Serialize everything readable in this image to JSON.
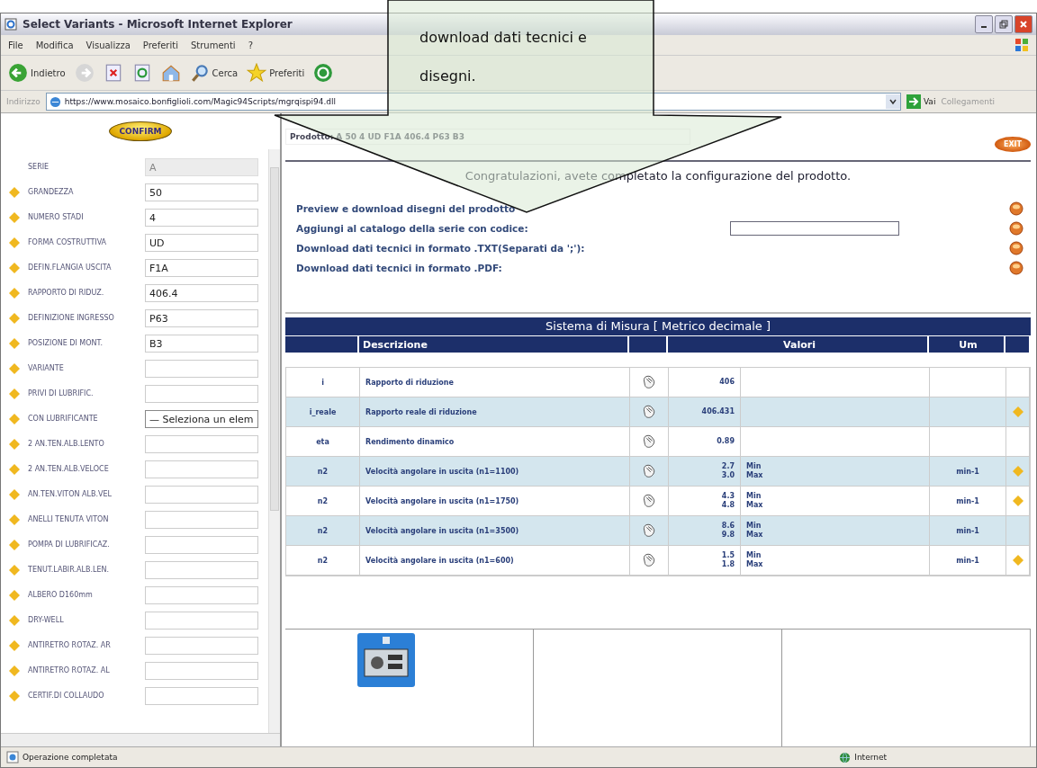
{
  "callout": {
    "text": "download dati tecnici e disegni."
  },
  "window": {
    "title": "Select Variants - Microsoft Internet Explorer"
  },
  "menu": [
    "File",
    "Modifica",
    "Visualizza",
    "Preferiti",
    "Strumenti",
    "?"
  ],
  "toolbar": [
    {
      "kind": "back",
      "label": "Indietro"
    },
    {
      "kind": "forward"
    },
    {
      "kind": "stop"
    },
    {
      "kind": "refresh"
    },
    {
      "kind": "home"
    },
    {
      "kind": "search",
      "label": "Cerca"
    },
    {
      "kind": "favorites",
      "label": "Preferiti"
    },
    {
      "kind": "media"
    }
  ],
  "address": {
    "label": "Indirizzo",
    "url": "https://www.mosaico.bonfiglioli.com/Magic94Scripts/mgrqispi94.dll",
    "go": "Vai",
    "links": "Collegamenti"
  },
  "sidebar": {
    "confirm": "CONFIRM",
    "fields": [
      {
        "label": "SERIE",
        "value": "A",
        "kind": "text",
        "required": false,
        "disabled": true
      },
      {
        "label": "GRANDEZZA",
        "value": "50",
        "kind": "text",
        "required": true,
        "disabled": false
      },
      {
        "label": "NUMERO STADI",
        "value": "4",
        "kind": "text",
        "required": true,
        "disabled": false
      },
      {
        "label": "FORMA COSTRUTTIVA",
        "value": "UD",
        "kind": "text",
        "required": true,
        "disabled": false
      },
      {
        "label": "DEFIN.FLANGIA USCITA",
        "value": "F1A",
        "kind": "text",
        "required": true,
        "disabled": false
      },
      {
        "label": "RAPPORTO DI RIDUZ.",
        "value": "406.4",
        "kind": "text",
        "required": true,
        "disabled": false
      },
      {
        "label": "DEFINIZIONE INGRESSO",
        "value": "P63",
        "kind": "text",
        "required": true,
        "disabled": false
      },
      {
        "label": "POSIZIONE DI MONT.",
        "value": "B3",
        "kind": "text",
        "required": true,
        "disabled": false
      },
      {
        "label": "VARIANTE",
        "kind": "text",
        "required": true,
        "disabled": false
      },
      {
        "label": "PRIVI DI LUBRIFIC.",
        "kind": "text",
        "required": true,
        "disabled": false
      },
      {
        "label": "CON LUBRIFICANTE",
        "value": "— Seleziona un elem",
        "kind": "select",
        "required": true,
        "disabled": false
      },
      {
        "label": "2 AN.TEN.ALB.LENTO",
        "kind": "text",
        "required": true,
        "disabled": false
      },
      {
        "label": "2 AN.TEN.ALB.VELOCE",
        "kind": "text",
        "required": true,
        "disabled": false
      },
      {
        "label": "AN.TEN.VITON ALB.VEL",
        "kind": "text",
        "required": true,
        "disabled": false
      },
      {
        "label": "ANELLI TENUTA VITON",
        "kind": "text",
        "required": true,
        "disabled": false
      },
      {
        "label": "POMPA DI LUBRIFICAZ.",
        "kind": "text",
        "required": true,
        "disabled": false
      },
      {
        "label": "TENUT.LABIR.ALB.LEN.",
        "kind": "text",
        "required": true,
        "disabled": false
      },
      {
        "label": "ALBERO D160mm",
        "kind": "text",
        "required": true,
        "disabled": false
      },
      {
        "label": "DRY-WELL",
        "kind": "text",
        "required": true,
        "disabled": false
      },
      {
        "label": "ANTIRETRO ROTAZ. AR",
        "kind": "text",
        "required": true,
        "disabled": false
      },
      {
        "label": "ANTIRETRO ROTAZ. AL",
        "kind": "text",
        "required": true,
        "disabled": false
      },
      {
        "label": "CERTIF.DI COLLAUDO",
        "kind": "text",
        "required": true,
        "disabled": false
      }
    ]
  },
  "product": "Prodotto: A 50 4 UD F1A 406.4 P63 B3",
  "exit": "EXIT",
  "message": "Congratulazioni, avete completato la configurazione del prodotto.",
  "actions": [
    {
      "label": "Preview e download disegni del prodotto",
      "kind": "link"
    },
    {
      "label": "Aggiungi al catalogo della serie con codice:",
      "kind": "input"
    },
    {
      "label": "Download dati tecnici in formato .TXT(Separati da ';'):",
      "kind": "link"
    },
    {
      "label": "Download dati tecnici in formato .PDF:",
      "kind": "link"
    }
  ],
  "table": {
    "title": "Sistema di Misura [ Metrico decimale ]",
    "columns": [
      "Descrizione",
      "Valori",
      "Um"
    ],
    "rows": [
      {
        "symbol": "i",
        "description": "Rapporto di riduzione",
        "values": [
          {
            "value": "406"
          }
        ],
        "marked": false
      },
      {
        "symbol": "i_reale",
        "description": "Rapporto reale di riduzione",
        "values": [
          {
            "value": "406.431"
          }
        ],
        "marked": true
      },
      {
        "symbol": "eta",
        "description": "Rendimento dinamico",
        "values": [
          {
            "value": "0.89"
          }
        ],
        "marked": false
      },
      {
        "symbol": "n2",
        "description": "Velocità angolare in uscita (n1=1100)",
        "values": [
          {
            "value": "2.7",
            "label": "Min"
          },
          {
            "value": "3.0",
            "label": "Max"
          }
        ],
        "unit": "min-1",
        "marked": true
      },
      {
        "symbol": "n2",
        "description": "Velocità angolare in uscita (n1=1750)",
        "values": [
          {
            "value": "4.3",
            "label": "Min"
          },
          {
            "value": "4.8",
            "label": "Max"
          }
        ],
        "unit": "min-1",
        "marked": true
      },
      {
        "symbol": "n2",
        "description": "Velocità angolare in uscita (n1=3500)",
        "values": [
          {
            "value": "8.6",
            "label": "Min"
          },
          {
            "value": "9.8",
            "label": "Max"
          }
        ],
        "unit": "min-1",
        "marked": false
      },
      {
        "symbol": "n2",
        "description": "Velocità angolare in uscita (n1=600)",
        "values": [
          {
            "value": "1.5",
            "label": "Min"
          },
          {
            "value": "1.8",
            "label": "Max"
          }
        ],
        "unit": "min-1",
        "marked": true
      }
    ]
  },
  "status_bar": {
    "text": "Operazione completata",
    "zone": "Internet"
  }
}
